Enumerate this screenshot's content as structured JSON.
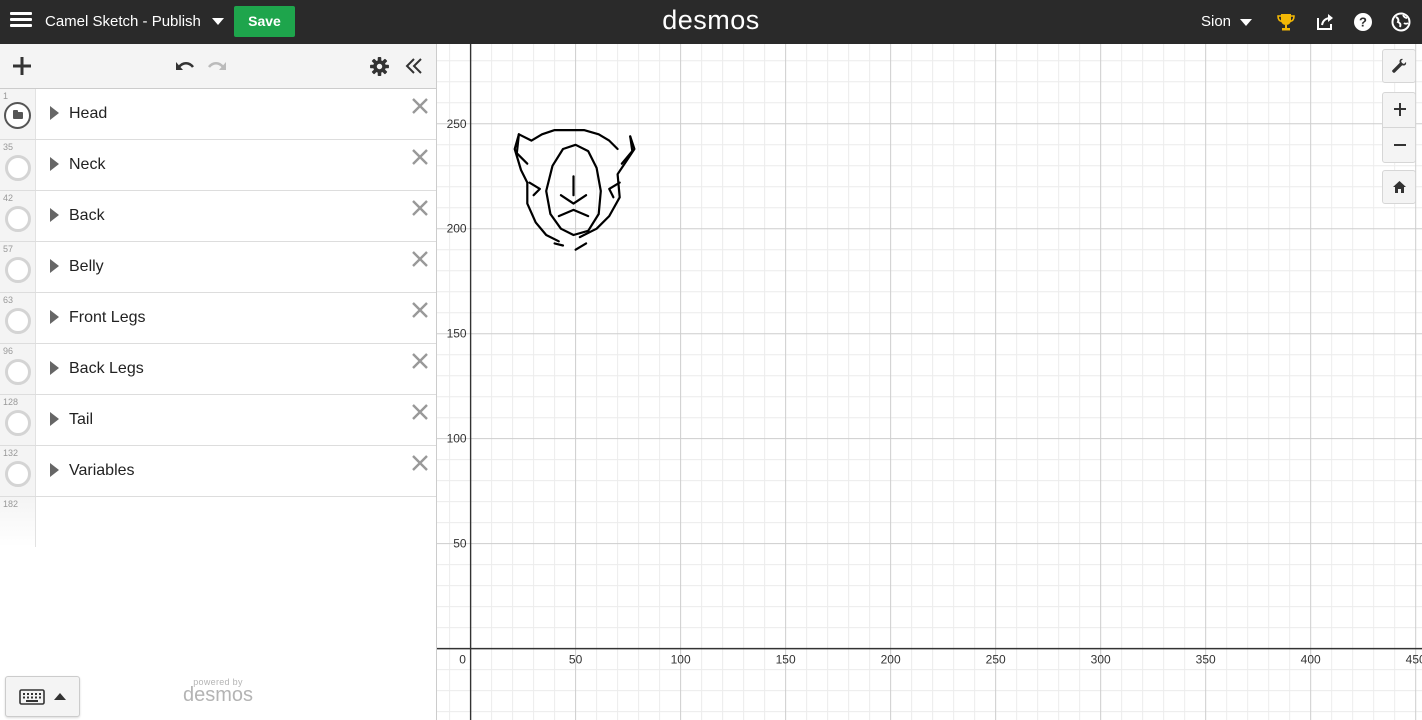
{
  "header": {
    "title": "Camel Sketch - Publish",
    "save_label": "Save",
    "brand": "desmos",
    "user_name": "Sion",
    "icons": [
      "hamburger-menu-icon",
      "trophy-icon",
      "share-icon",
      "help-icon",
      "language-globe-icon"
    ]
  },
  "toolbar": {
    "icons": [
      "add-icon",
      "undo-icon",
      "redo-icon",
      "settings-gear-icon",
      "collapse-panel-icon"
    ]
  },
  "expressions": [
    {
      "number": "1",
      "label": "Head",
      "kind": "folder"
    },
    {
      "number": "35",
      "label": "Neck",
      "kind": "folder"
    },
    {
      "number": "42",
      "label": "Back",
      "kind": "folder"
    },
    {
      "number": "57",
      "label": "Belly",
      "kind": "folder"
    },
    {
      "number": "63",
      "label": "Front Legs",
      "kind": "folder"
    },
    {
      "number": "96",
      "label": "Back Legs",
      "kind": "folder"
    },
    {
      "number": "128",
      "label": "Tail",
      "kind": "folder"
    },
    {
      "number": "132",
      "label": "Variables",
      "kind": "folder"
    }
  ],
  "next_expression_number": "182",
  "footer": {
    "powered_by": "powered by",
    "brand": "desmos"
  },
  "graph": {
    "x_ticks": [
      "0",
      "50",
      "100",
      "150",
      "200",
      "250",
      "300",
      "350",
      "400",
      "450"
    ],
    "y_ticks": [
      "250",
      "200",
      "150",
      "100",
      "50"
    ],
    "xlim": [
      -16,
      453
    ],
    "ylim": [
      -34,
      288
    ],
    "major_step": 50,
    "minor_step": 10,
    "sketch_color": "#000000"
  }
}
